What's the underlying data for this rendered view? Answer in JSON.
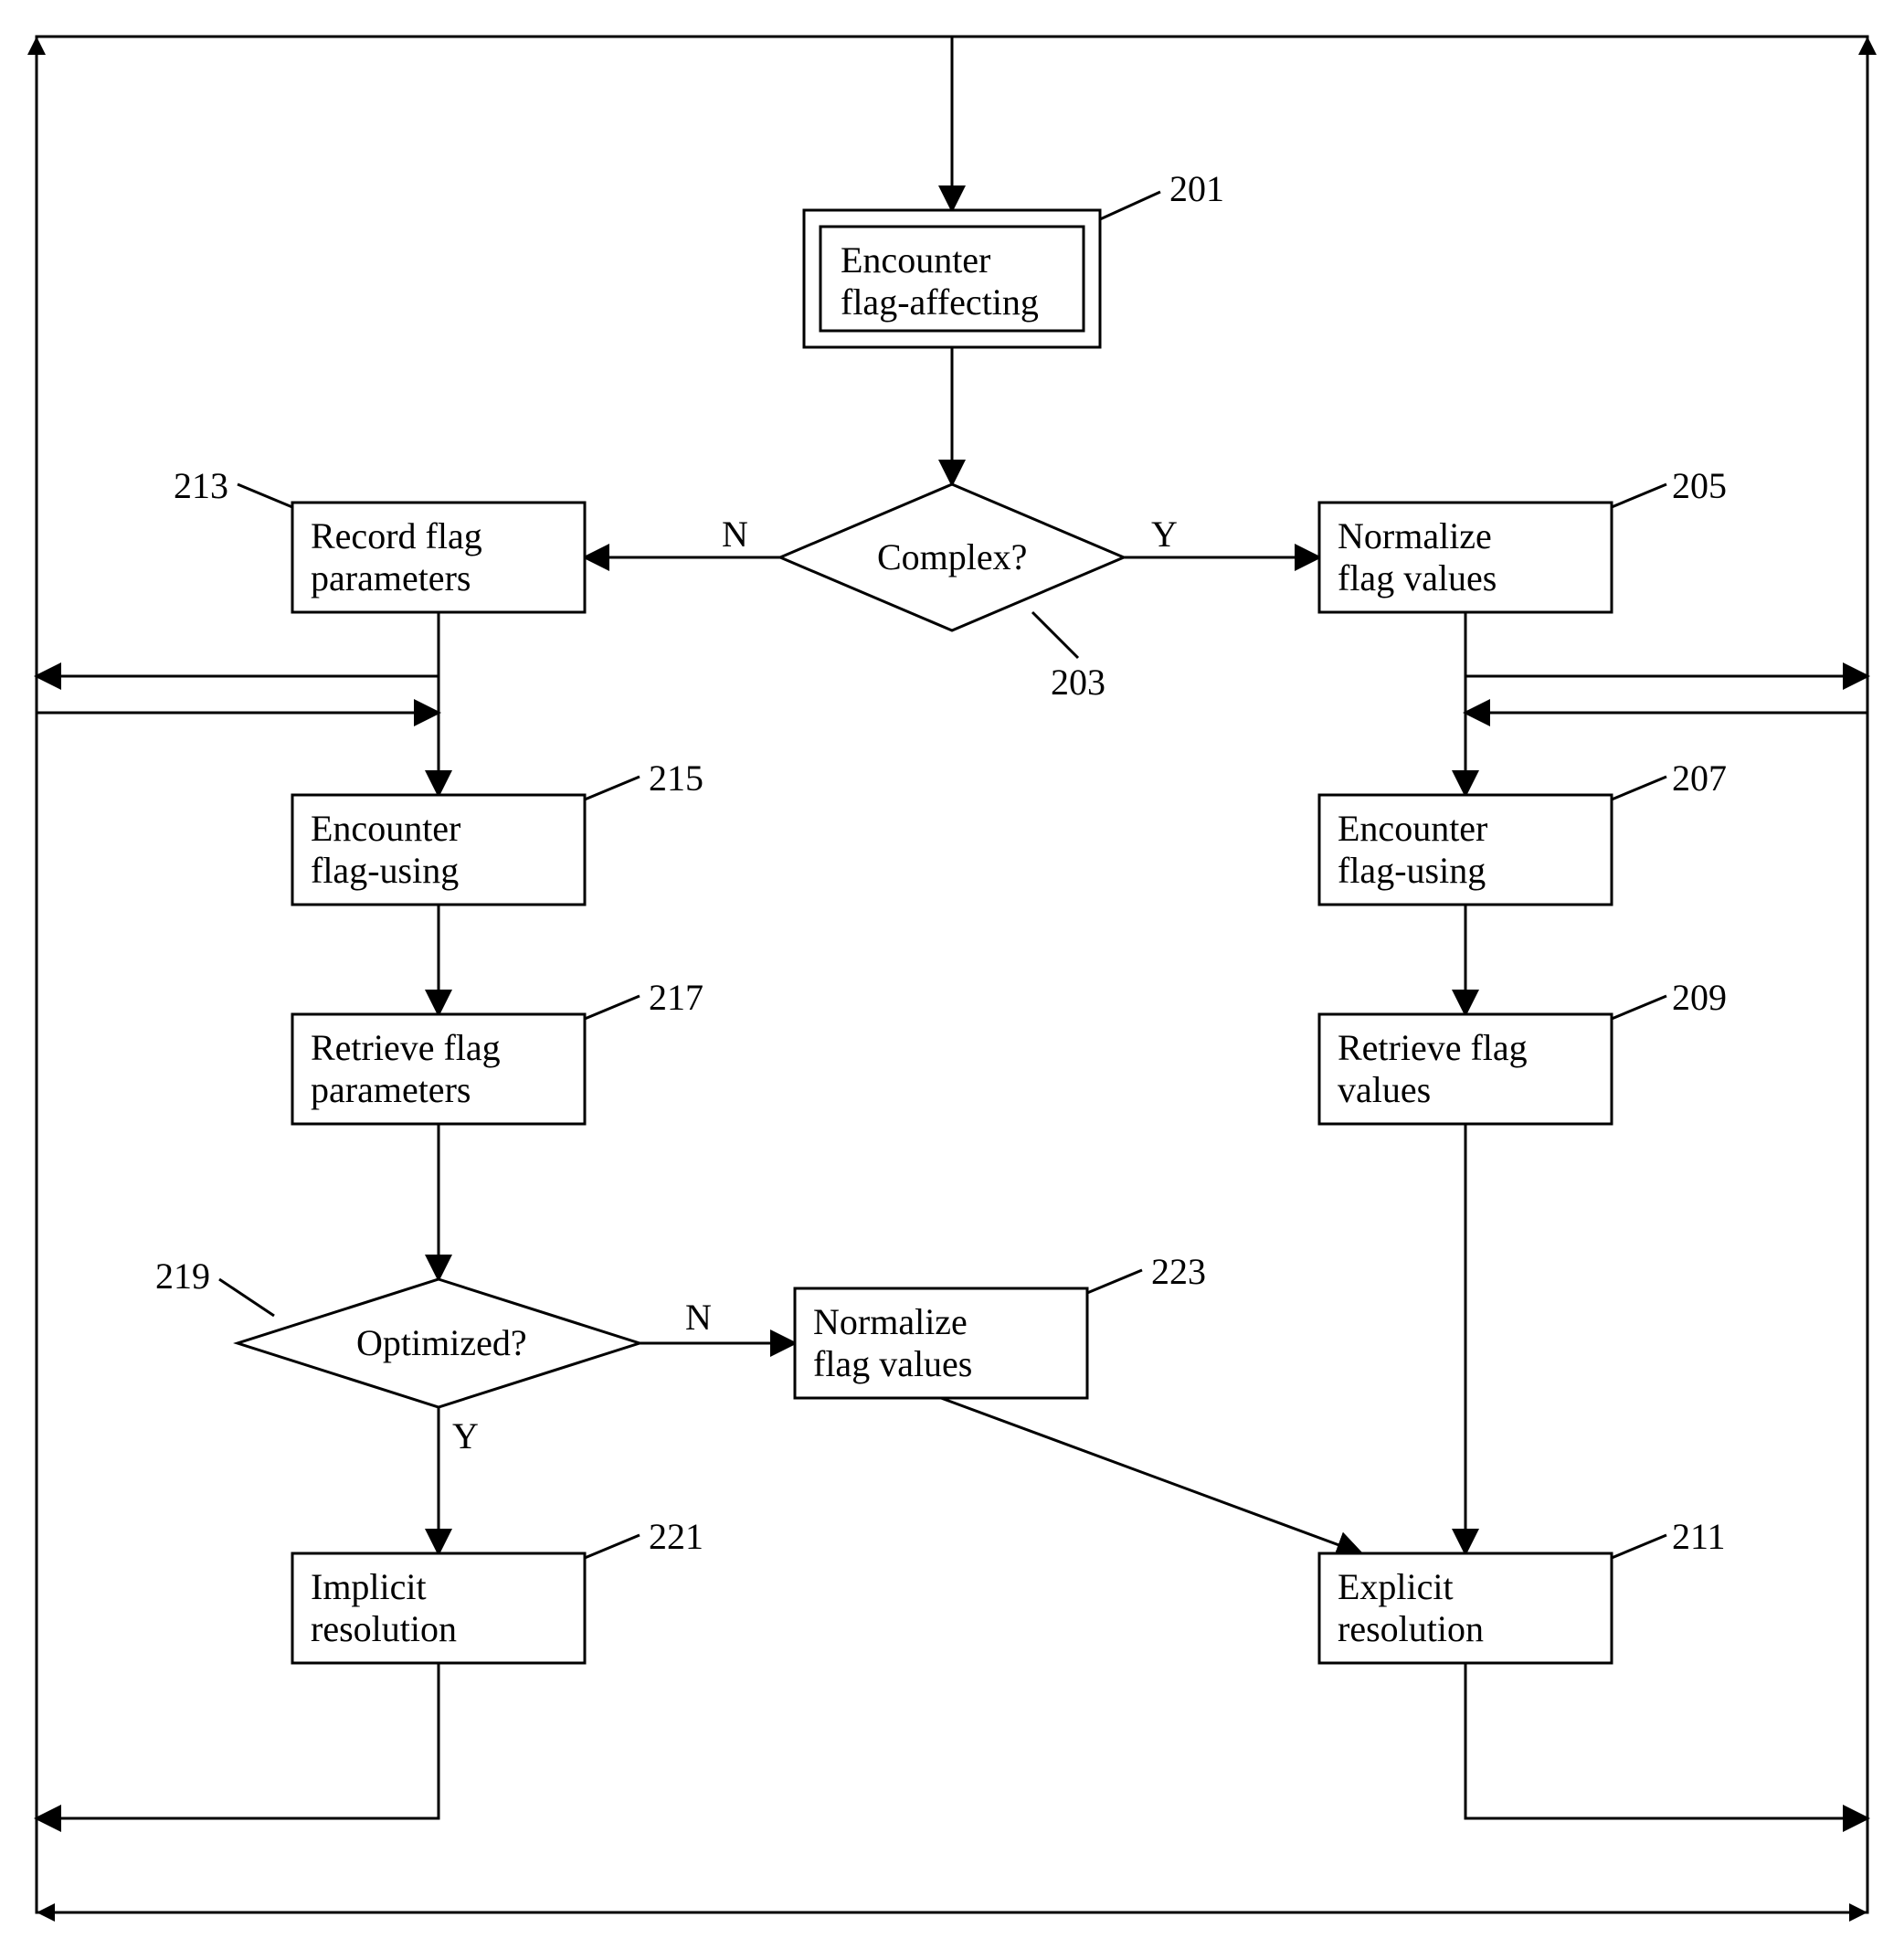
{
  "nodes": {
    "n201": {
      "label1": "Encounter",
      "label2": "flag-affecting",
      "ref": "201"
    },
    "n203": {
      "label": "Complex?",
      "ref": "203",
      "labelN": "N",
      "labelY": "Y"
    },
    "n205": {
      "label1": "Normalize",
      "label2": "flag values",
      "ref": "205"
    },
    "n207": {
      "label1": "Encounter",
      "label2": "flag-using",
      "ref": "207"
    },
    "n209": {
      "label1": "Retrieve    flag",
      "label2": "values",
      "ref": "209"
    },
    "n211": {
      "label1": "Explicit",
      "label2": "resolution",
      "ref": "211"
    },
    "n213": {
      "label1": "Record flag",
      "label2": "parameters",
      "ref": "213"
    },
    "n215": {
      "label1": "Encounter",
      "label2": "flag-using",
      "ref": "215"
    },
    "n217": {
      "label1": "Retrieve flag",
      "label2": "parameters",
      "ref": "217"
    },
    "n219": {
      "label": "Optimized?",
      "ref": "219",
      "labelN": "N",
      "labelY": "Y"
    },
    "n221": {
      "label1": "Implicit",
      "label2": "resolution",
      "ref": "221"
    },
    "n223": {
      "label1": "Normalize",
      "label2": "flag values",
      "ref": "223"
    }
  }
}
